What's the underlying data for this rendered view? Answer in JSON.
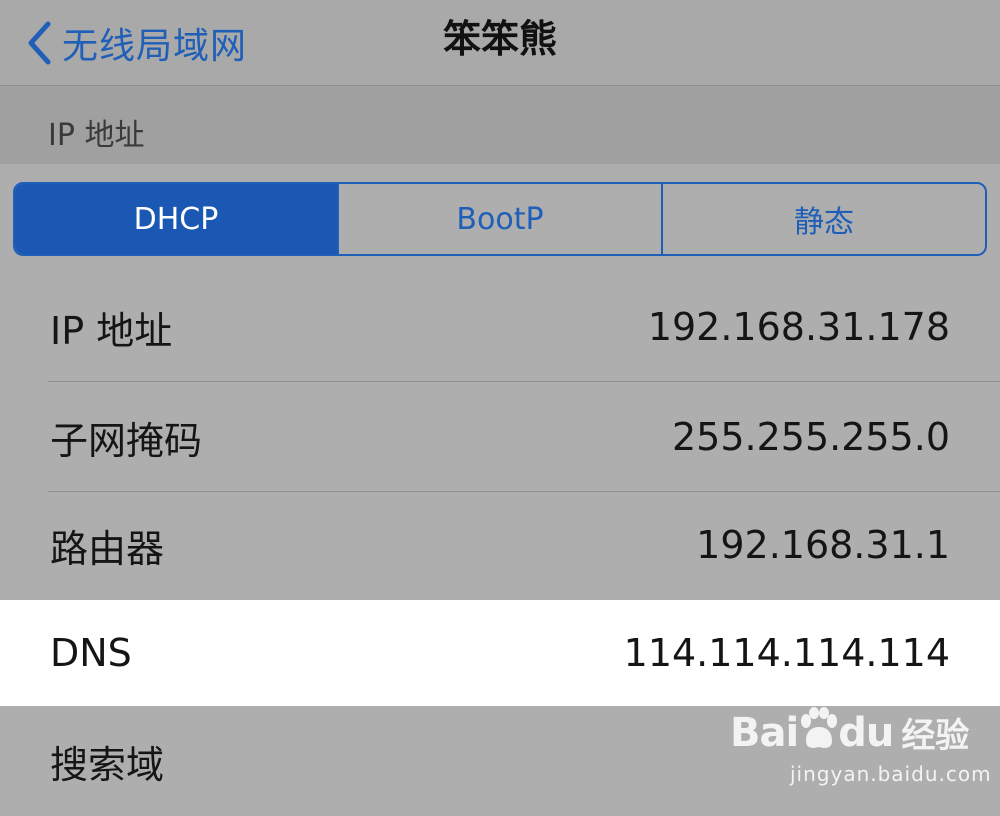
{
  "nav": {
    "back_label": "无线局域网",
    "title": "笨笨熊"
  },
  "section": {
    "header": "IP 地址"
  },
  "segmented": {
    "options": [
      "DHCP",
      "BootP",
      "静态"
    ],
    "selected": "DHCP"
  },
  "rows": [
    {
      "label": "IP 地址",
      "value": "192.168.31.178"
    },
    {
      "label": "子网掩码",
      "value": "255.255.255.0"
    },
    {
      "label": "路由器",
      "value": "192.168.31.1"
    },
    {
      "label": "DNS",
      "value": "114.114.114.114"
    },
    {
      "label": "搜索域",
      "value": ""
    }
  ],
  "watermark": {
    "brand_latin": "Bai",
    "brand_latin_suffix": "du",
    "brand_cn": "经验",
    "url": "jingyan.baidu.com"
  },
  "colors": {
    "accent": "#1f5fb8",
    "background": "#aeaeae",
    "highlight_row": "#ffffff"
  },
  "icons": {
    "back": "chevron-left-icon",
    "watermark_paw": "paw-icon"
  }
}
